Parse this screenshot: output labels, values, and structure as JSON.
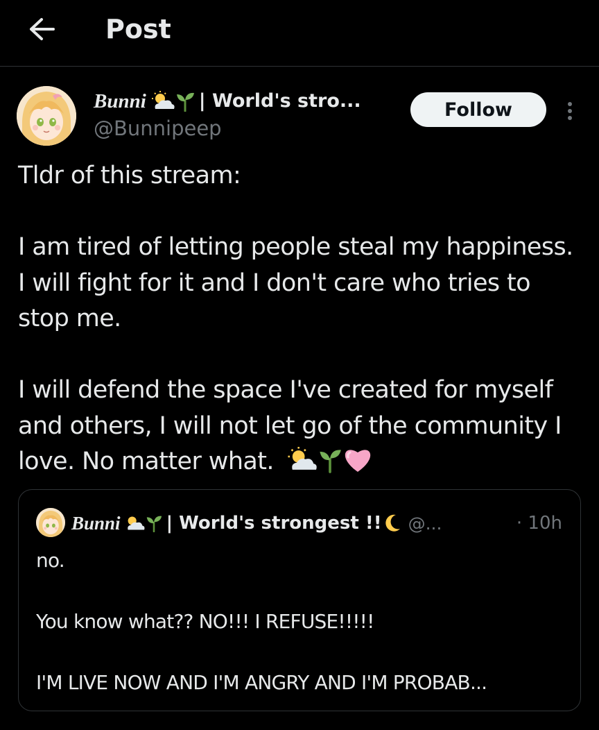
{
  "header": {
    "title": "Post",
    "back_icon": "arrow-left-icon"
  },
  "post": {
    "author": {
      "name": "Bunni",
      "name_emojis": [
        "sun-behind-cloud-emoji",
        "seedling-emoji"
      ],
      "name_suffix": "| World's stro...",
      "handle": "@Bunnipeep"
    },
    "follow_label": "Follow",
    "more_icon": "vertical-ellipsis-icon",
    "text": "Tldr of this stream:\n\nI am tired of letting people steal my happiness. I will fight for it and I don't care who tries to stop me.\n\nI will defend the space I've created for myself and others, I will not let go of the community I love. No matter what.",
    "trailing_emojis": [
      "sun-behind-cloud-emoji",
      "seedling-emoji",
      "pink-heart-emoji"
    ]
  },
  "quoted_post": {
    "author": {
      "name": "Bunni",
      "name_suffix": "| World's strongest !!",
      "handle": "@...",
      "time": "· 10h"
    },
    "text": "no.\n\nYou know what?? NO!!! I REFUSE!!!!!\n\nI'M LIVE NOW AND I'M ANGRY AND I'M PROBAB..."
  },
  "colors": {
    "background": "#000000",
    "text_primary": "#e7e9ea",
    "text_secondary": "#71767b",
    "border": "#2f3336",
    "follow_bg": "#eff3f4",
    "follow_text": "#0f1419",
    "heart": "#f7a6c7",
    "seedling": "#78b159"
  }
}
